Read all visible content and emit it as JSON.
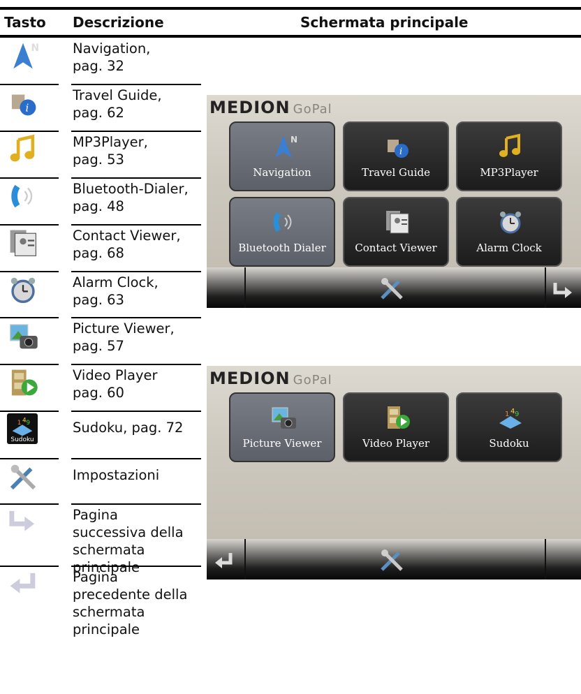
{
  "header": {
    "col1": "Tasto",
    "col2": "Descrizione",
    "col3": "Schermata principale"
  },
  "rows": [
    {
      "icon": "navigation-arrow-icon",
      "desc": [
        "Navigation,",
        "pag. 32"
      ]
    },
    {
      "icon": "travel-guide-icon",
      "desc": [
        "Travel Guide,",
        "pag. 62"
      ]
    },
    {
      "icon": "music-note-icon",
      "desc": [
        "MP3Player,",
        "pag. 53"
      ]
    },
    {
      "icon": "phone-bluetooth-icon",
      "desc": [
        "Bluetooth-Dialer,",
        "pag. 48"
      ]
    },
    {
      "icon": "contact-cards-icon",
      "desc": [
        "Contact Viewer,",
        "pag. 68"
      ]
    },
    {
      "icon": "alarm-clock-icon",
      "desc": [
        "Alarm Clock,",
        "pag. 63"
      ]
    },
    {
      "icon": "picture-camera-icon",
      "desc": [
        "Picture Viewer,",
        "pag. 57"
      ]
    },
    {
      "icon": "video-film-icon",
      "desc": [
        "Video Player",
        "pag. 60"
      ]
    },
    {
      "icon": "sudoku-icon",
      "desc": [
        "Sudoku, pag. 72"
      ],
      "icon_text": "Sudoku"
    },
    {
      "icon": "settings-tools-icon",
      "desc": [
        "Impostazioni"
      ]
    },
    {
      "icon": "next-page-arrow-icon",
      "desc": [
        "Pagina",
        "successiva della",
        "schermata",
        "principale"
      ]
    },
    {
      "icon": "previous-page-arrow-icon",
      "desc": [
        "Pagina",
        "precedente della",
        "schermata",
        "principale"
      ]
    }
  ],
  "screen1": {
    "brand": "MEDION",
    "brand_sub": "GoPal",
    "tiles": [
      {
        "label": "Navigation",
        "icon": "navigation-arrow-icon",
        "selected": true
      },
      {
        "label": "Travel Guide",
        "icon": "travel-guide-icon"
      },
      {
        "label": "MP3Player",
        "icon": "music-note-icon"
      },
      {
        "label": "Bluetooth Dialer",
        "icon": "phone-bluetooth-icon",
        "selected": true
      },
      {
        "label": "Contact Viewer",
        "icon": "contact-cards-icon"
      },
      {
        "label": "Alarm Clock",
        "icon": "alarm-clock-icon"
      }
    ]
  },
  "screen2": {
    "brand": "MEDION",
    "brand_sub": "GoPal",
    "tiles": [
      {
        "label": "Picture Viewer",
        "icon": "picture-camera-icon",
        "selected": true
      },
      {
        "label": "Video Player",
        "icon": "video-film-icon"
      },
      {
        "label": "Sudoku",
        "icon": "sudoku-icon"
      }
    ]
  }
}
